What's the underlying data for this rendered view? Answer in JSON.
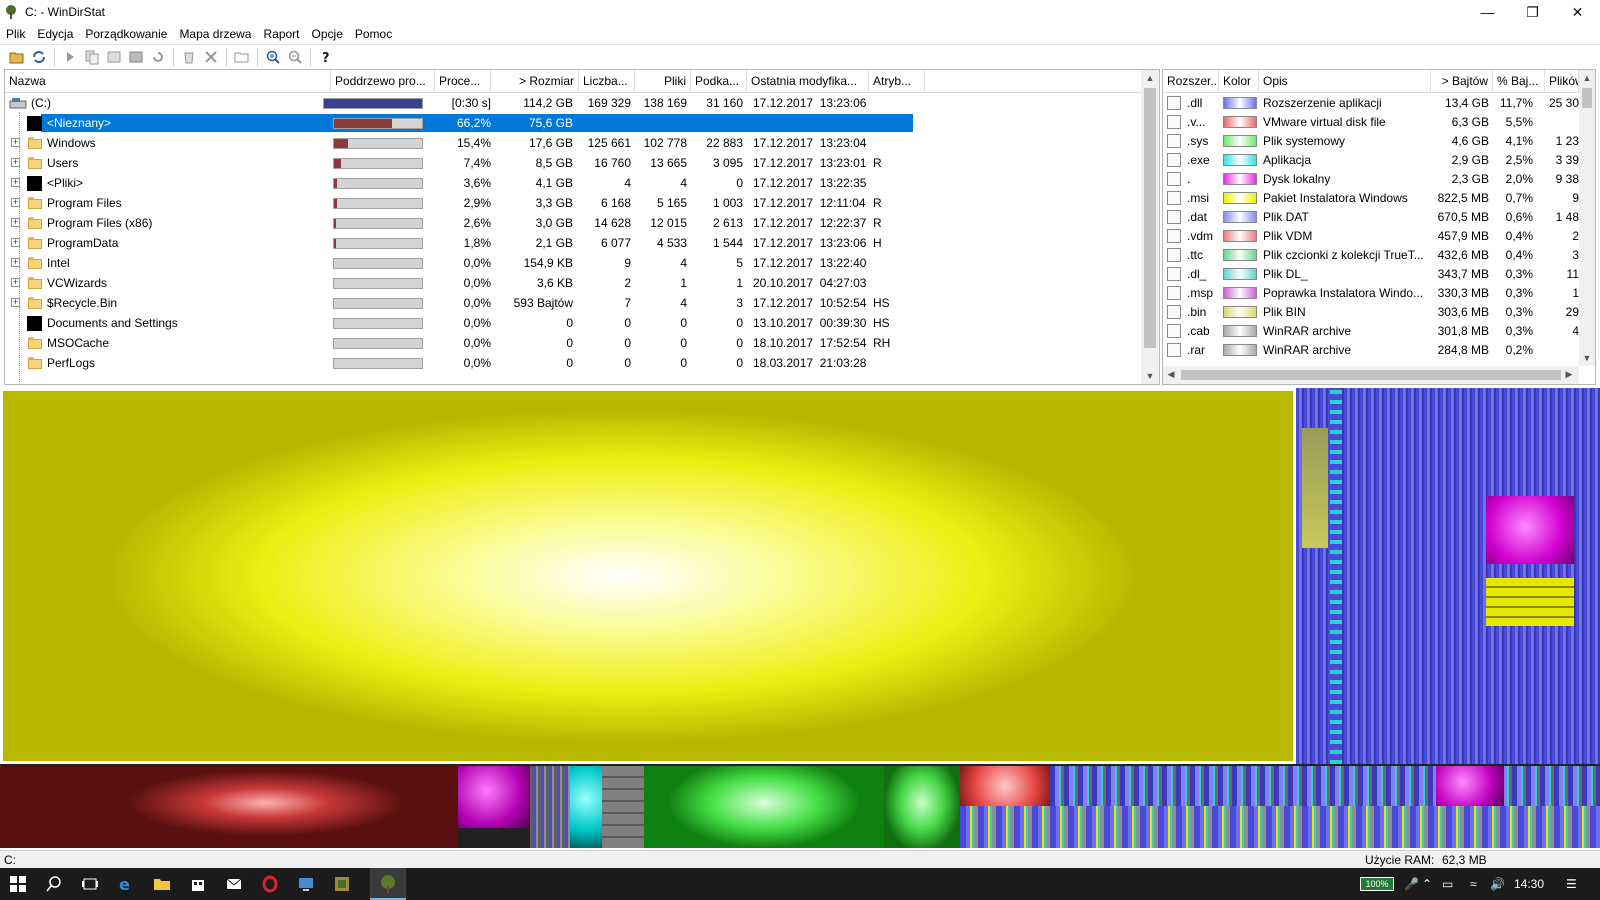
{
  "window": {
    "title": "C: - WinDirStat"
  },
  "menu": [
    "Plik",
    "Edycja",
    "Porządkowanie",
    "Mapa drzewa",
    "Raport",
    "Opcje",
    "Pomoc"
  ],
  "tree": {
    "columns": [
      "Nazwa",
      "Poddrzewo pro...",
      "Proce...",
      "> Rozmiar",
      "Liczba...",
      "Pliki",
      "Podka...",
      "Ostatnia modyfika...",
      "Atryb..."
    ],
    "rows": [
      {
        "name": "(C:)",
        "percent": "[0:30 s]",
        "size": "114,2 GB",
        "items": "169 329",
        "files": "138 169",
        "subdirs": "31 160",
        "modified": "17.12.2017  13:23:06",
        "attr": "",
        "bar_fraction": 1.0,
        "icon": "drive-icon",
        "level": 0,
        "expander": false
      },
      {
        "name": "<Nieznany>",
        "percent": "66,2%",
        "size": "75,6 GB",
        "items": "",
        "files": "",
        "subdirs": "",
        "modified": "",
        "attr": "",
        "bar_fraction": 0.662,
        "icon": "black-icon",
        "level": 1,
        "expander": false,
        "selected": true
      },
      {
        "name": "Windows",
        "percent": "15,4%",
        "size": "17,6 GB",
        "items": "125 661",
        "files": "102 778",
        "subdirs": "22 883",
        "modified": "17.12.2017  13:23:04",
        "attr": "",
        "bar_fraction": 0.154,
        "icon": "folder-icon",
        "level": 1,
        "expander": true
      },
      {
        "name": "Users",
        "percent": "7,4%",
        "size": "8,5 GB",
        "items": "16 760",
        "files": "13 665",
        "subdirs": "3 095",
        "modified": "17.12.2017  13:23:01",
        "attr": "R",
        "bar_fraction": 0.074,
        "icon": "folder-icon",
        "level": 1,
        "expander": true
      },
      {
        "name": "<Pliki>",
        "percent": "3,6%",
        "size": "4,1 GB",
        "items": "4",
        "files": "4",
        "subdirs": "0",
        "modified": "17.12.2017  13:22:35",
        "attr": "",
        "bar_fraction": 0.036,
        "icon": "black-icon",
        "level": 1,
        "expander": true
      },
      {
        "name": "Program Files",
        "percent": "2,9%",
        "size": "3,3 GB",
        "items": "6 168",
        "files": "5 165",
        "subdirs": "1 003",
        "modified": "17.12.2017  12:11:04",
        "attr": "R",
        "bar_fraction": 0.029,
        "icon": "folder-icon",
        "level": 1,
        "expander": true
      },
      {
        "name": "Program Files (x86)",
        "percent": "2,6%",
        "size": "3,0 GB",
        "items": "14 628",
        "files": "12 015",
        "subdirs": "2 613",
        "modified": "17.12.2017  12:22:37",
        "attr": "R",
        "bar_fraction": 0.026,
        "icon": "folder-icon",
        "level": 1,
        "expander": true
      },
      {
        "name": "ProgramData",
        "percent": "1,8%",
        "size": "2,1 GB",
        "items": "6 077",
        "files": "4 533",
        "subdirs": "1 544",
        "modified": "17.12.2017  13:23:06",
        "attr": "H",
        "bar_fraction": 0.018,
        "icon": "folder-icon",
        "level": 1,
        "expander": true
      },
      {
        "name": "Intel",
        "percent": "0,0%",
        "size": "154,9 KB",
        "items": "9",
        "files": "4",
        "subdirs": "5",
        "modified": "17.12.2017  13:22:40",
        "attr": "",
        "bar_fraction": 0.0,
        "icon": "folder-icon",
        "level": 1,
        "expander": true
      },
      {
        "name": "VCWizards",
        "percent": "0,0%",
        "size": "3,6 KB",
        "items": "2",
        "files": "1",
        "subdirs": "1",
        "modified": "20.10.2017  04:27:03",
        "attr": "",
        "bar_fraction": 0.0,
        "icon": "folder-icon",
        "level": 1,
        "expander": true
      },
      {
        "name": "$Recycle.Bin",
        "percent": "0,0%",
        "size": "593 Bajtów",
        "items": "7",
        "files": "4",
        "subdirs": "3",
        "modified": "17.12.2017  10:52:54",
        "attr": "HS",
        "bar_fraction": 0.0,
        "icon": "folder-icon",
        "level": 1,
        "expander": true
      },
      {
        "name": "Documents and Settings",
        "percent": "0,0%",
        "size": "0",
        "items": "0",
        "files": "0",
        "subdirs": "0",
        "modified": "13.10.2017  00:39:30",
        "attr": "HS",
        "bar_fraction": 0.0,
        "icon": "black-icon",
        "level": 1,
        "expander": false
      },
      {
        "name": "MSOCache",
        "percent": "0,0%",
        "size": "0",
        "items": "0",
        "files": "0",
        "subdirs": "0",
        "modified": "18.10.2017  17:52:54",
        "attr": "RH",
        "bar_fraction": 0.0,
        "icon": "folder-icon",
        "level": 1,
        "expander": false
      },
      {
        "name": "PerfLogs",
        "percent": "0,0%",
        "size": "0",
        "items": "0",
        "files": "0",
        "subdirs": "0",
        "modified": "18.03.2017  21:03:28",
        "attr": "",
        "bar_fraction": 0.0,
        "icon": "folder-icon",
        "level": 1,
        "expander": false
      }
    ]
  },
  "extensions": {
    "columns": [
      "Rozszer...",
      "Kolor",
      "Opis",
      "> Bajtów",
      "% Baj...",
      "Plików"
    ],
    "rows": [
      {
        "ext": ".dll",
        "color": "#6f6ff2",
        "desc": "Rozszerzenie aplikacji",
        "bytes": "13,4 GB",
        "pct": "11,7%",
        "files": "25 30"
      },
      {
        "ext": ".v...",
        "color": "#f06a6a",
        "desc": "VMware virtual disk file",
        "bytes": "6,3 GB",
        "pct": "5,5%",
        "files": ""
      },
      {
        "ext": ".sys",
        "color": "#6ee86e",
        "desc": "Plik systemowy",
        "bytes": "4,6 GB",
        "pct": "4,1%",
        "files": "1 23"
      },
      {
        "ext": ".exe",
        "color": "#2ee6e6",
        "desc": "Aplikacja",
        "bytes": "2,9 GB",
        "pct": "2,5%",
        "files": "3 39"
      },
      {
        "ext": ".",
        "color": "#e62ee6",
        "desc": "Dysk lokalny",
        "bytes": "2,3 GB",
        "pct": "2,0%",
        "files": "9 38"
      },
      {
        "ext": ".msi",
        "color": "#f2f200",
        "desc": "Pakiet Instalatora Windows",
        "bytes": "822,5 MB",
        "pct": "0,7%",
        "files": "9"
      },
      {
        "ext": ".dat",
        "color": "#8a8af0",
        "desc": "Plik DAT",
        "bytes": "670,5 MB",
        "pct": "0,6%",
        "files": "1 48"
      },
      {
        "ext": ".vdm",
        "color": "#f07a7a",
        "desc": "Plik VDM",
        "bytes": "457,9 MB",
        "pct": "0,4%",
        "files": "2"
      },
      {
        "ext": ".ttc",
        "color": "#66d68a",
        "desc": "Plik czcionki z kolekcji TrueT...",
        "bytes": "432,6 MB",
        "pct": "0,4%",
        "files": "3"
      },
      {
        "ext": ".dl_",
        "color": "#5fd0d0",
        "desc": "Plik DL_",
        "bytes": "343,7 MB",
        "pct": "0,3%",
        "files": "11"
      },
      {
        "ext": ".msp",
        "color": "#d060d0",
        "desc": "Poprawka Instalatora Windo...",
        "bytes": "330,3 MB",
        "pct": "0,3%",
        "files": "1"
      },
      {
        "ext": ".bin",
        "color": "#d6d66a",
        "desc": "Plik BIN",
        "bytes": "303,6 MB",
        "pct": "0,3%",
        "files": "29"
      },
      {
        "ext": ".cab",
        "color": "#a8a8a8",
        "desc": "WinRAR archive",
        "bytes": "301,8 MB",
        "pct": "0,3%",
        "files": "4"
      },
      {
        "ext": ".rar",
        "color": "#a8a8a8",
        "desc": "WinRAR archive",
        "bytes": "284,8 MB",
        "pct": "0,2%",
        "files": ""
      }
    ]
  },
  "status": {
    "path": "C:",
    "ram_label": "Użycie RAM:",
    "ram_value": "62,3 MB"
  },
  "taskbar": {
    "battery": "100%",
    "clock": "14:30"
  }
}
